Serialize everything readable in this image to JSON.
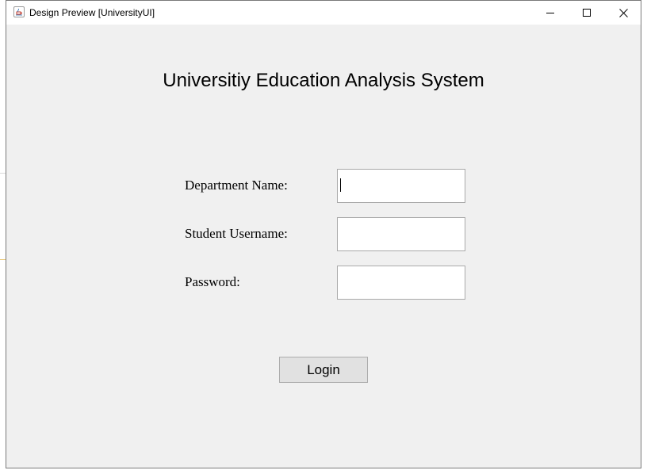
{
  "window": {
    "title": "Design Preview [UniversityUI]",
    "icon": "java-cup-icon",
    "controls": [
      "minimize-icon",
      "maximize-icon",
      "close-icon"
    ]
  },
  "form": {
    "heading": "Universitiy Education Analysis System",
    "department_label": "Department Name:",
    "department_value": "",
    "username_label": "Student Username:",
    "username_value": "",
    "password_label": "Password:",
    "password_value": "",
    "login_label": "Login"
  },
  "colors": {
    "window_background": "#f0f0f0",
    "titlebar_background": "#ffffff",
    "field_border": "#a9a9a9",
    "button_background": "#e1e1e1",
    "button_border": "#adadad"
  }
}
